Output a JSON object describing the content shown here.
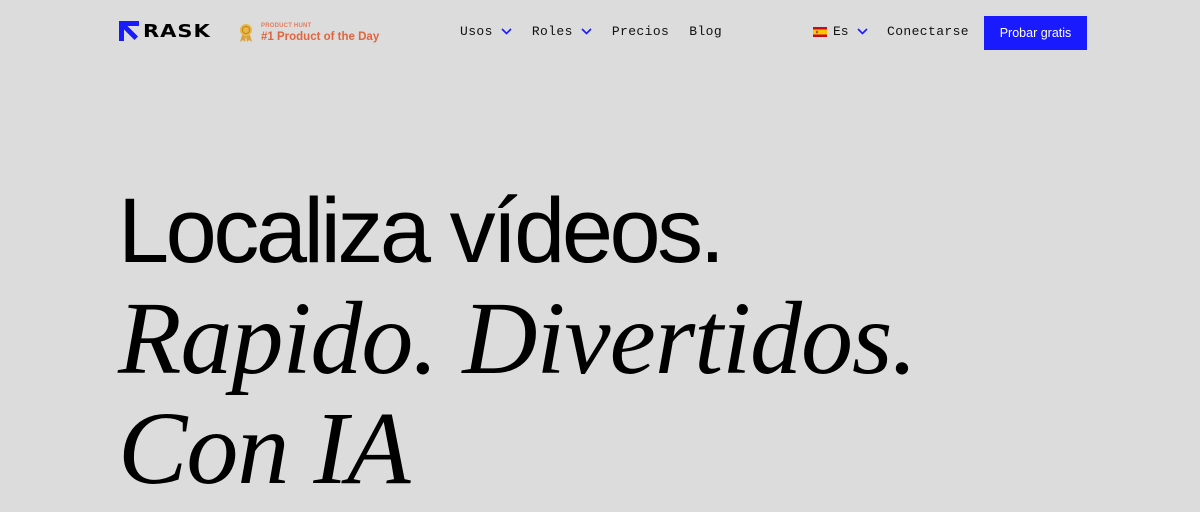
{
  "header": {
    "logo_text": "RASK",
    "product_hunt": {
      "label": "PRODUCT HUNT",
      "title": "#1 Product of the Day"
    },
    "nav": [
      {
        "label": "Usos",
        "has_dropdown": true
      },
      {
        "label": "Roles",
        "has_dropdown": true
      },
      {
        "label": "Precios",
        "has_dropdown": false
      },
      {
        "label": "Blog",
        "has_dropdown": false
      }
    ],
    "language": {
      "label": "Es",
      "flag": "spain-flag-icon"
    },
    "login_label": "Conectarse",
    "cta_label": "Probar gratis"
  },
  "hero": {
    "line1": "Localiza vídeos.",
    "line2": "Rapido. Divertidos.",
    "line3": "Con IA"
  },
  "colors": {
    "background": "#dcdcdc",
    "accent": "#1a1aff",
    "product_hunt": "#e0653f",
    "text": "#000000"
  }
}
